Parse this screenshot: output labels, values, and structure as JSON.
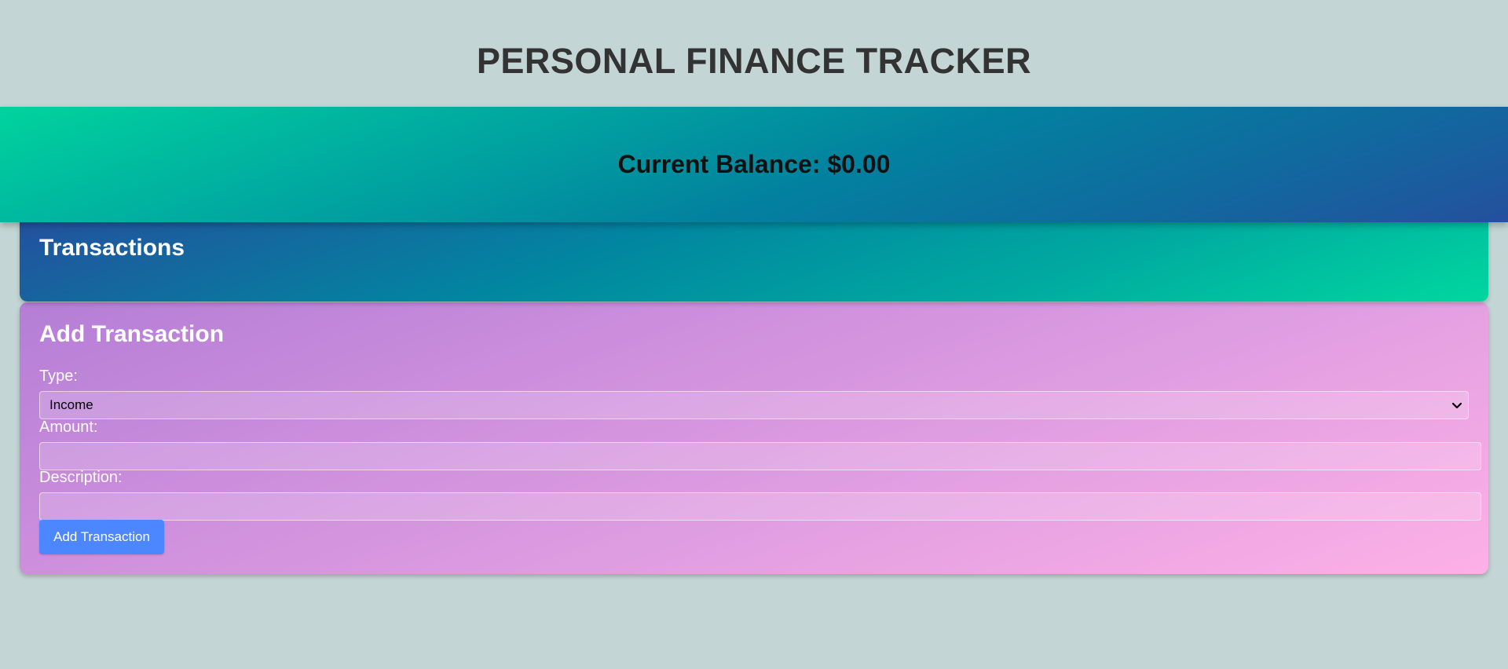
{
  "header": {
    "title": "PERSONAL FINANCE TRACKER"
  },
  "balance": {
    "text": "Current Balance: $0.00"
  },
  "transactions": {
    "title": "Transactions"
  },
  "add_form": {
    "title": "Add Transaction",
    "type_label": "Type:",
    "type_selected": "Income",
    "amount_label": "Amount:",
    "amount_value": "",
    "description_label": "Description:",
    "description_value": "",
    "submit_label": "Add Transaction"
  },
  "colors": {
    "background": "#c3d5d4",
    "button": "#4d87ff",
    "title_text": "#333333"
  },
  "icons": {
    "select_arrow": "chevron-down-icon"
  }
}
